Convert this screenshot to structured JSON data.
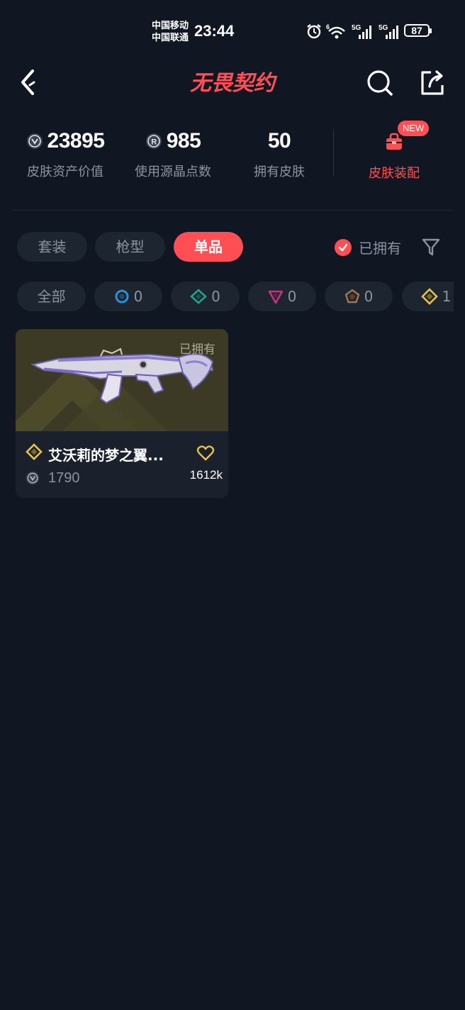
{
  "status_bar": {
    "carrier1": "中国移动",
    "carrier2": "中国联通",
    "time": "23:44",
    "battery": "87"
  },
  "header": {
    "title": "无畏契约",
    "brand_color": "#ff4f55"
  },
  "stats": {
    "asset_value": {
      "value": "23895",
      "label": "皮肤资产价值"
    },
    "points": {
      "value": "985",
      "label": "使用源晶点数"
    },
    "owned_count": {
      "value": "50",
      "label": "拥有皮肤"
    },
    "equip": {
      "label": "皮肤装配",
      "badge": "NEW"
    }
  },
  "tabs": [
    {
      "label": "套装"
    },
    {
      "label": "枪型"
    },
    {
      "label": "单品",
      "active": true
    }
  ],
  "owned_filter": {
    "label": "已拥有",
    "checked": true
  },
  "rarity_chips": [
    {
      "label": "全部"
    },
    {
      "count": "0",
      "icon": "select-tier-icon",
      "color": "#2e8fd6"
    },
    {
      "count": "0",
      "icon": "deluxe-tier-icon",
      "color": "#1fa38a"
    },
    {
      "count": "0",
      "icon": "premium-tier-icon",
      "color": "#c2357e"
    },
    {
      "count": "0",
      "icon": "ultra-tier-icon",
      "color": "#a8744e"
    },
    {
      "count": "1",
      "icon": "exclusive-tier-icon",
      "color": "#e6c24c"
    }
  ],
  "items": [
    {
      "owned_tag": "已拥有",
      "name": "艾沃莉的梦之翼...",
      "price": "1790",
      "likes": "1612k"
    }
  ]
}
